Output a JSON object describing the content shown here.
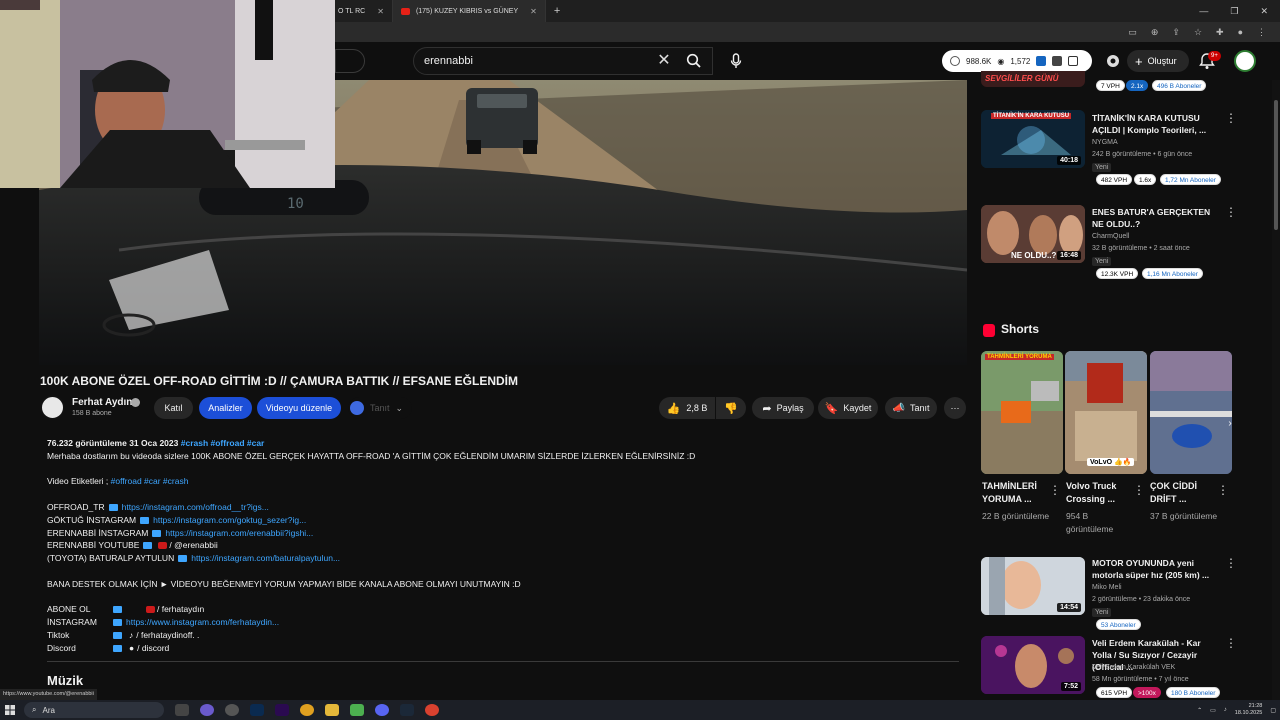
{
  "browser": {
    "tabs": [
      {
        "label": "O TL RC"
      },
      {
        "label": "(175) KUZEY KIBRIS vs GÜNEY"
      }
    ],
    "new_tab": "+"
  },
  "header": {
    "search_value": "erennabbi",
    "stats": {
      "views": "988.6K",
      "watching": "1,572"
    },
    "create_label": "Oluştur",
    "notifications": "9+"
  },
  "video": {
    "title": "100K ABONE ÖZEL OFF-ROAD GİTTİM :D // ÇAMURA BATTIK // EFSANE EĞLENDİM",
    "dash_display": "10"
  },
  "channel": {
    "name": "Ferhat Aydın",
    "subscribers": "158 B abone",
    "join_label": "Katıl",
    "analytics_label": "Analizler",
    "edit_label": "Videoyu düzenle",
    "promote_label": "Tanıt"
  },
  "actions": {
    "likes": "2,8 B",
    "share": "Paylaş",
    "save": "Kaydet",
    "clip": "Tanıt"
  },
  "description": {
    "views_date": "76.232 görüntüleme  31 Oca 2023",
    "hashtags": "#crash #offroad #car",
    "line1": "Merhaba dostlarım bu videoda sizlere 100K ABONE ÖZEL GERÇEK HAYATTA OFF-ROAD 'A GİTTİM ÇOK EĞLENDİM UMARIM SİZLERDE İZLERKEN EĞLENİRSİNİZ :D",
    "tags_label": "Video Etiketleri ; ",
    "tags": "#offroad  #car  #crash",
    "socials": [
      {
        "label": "OFFROAD_TR",
        "link": "https://instagram.com/offroad__tr?igs..."
      },
      {
        "label": "GÖKTUĞ İNSTAGRAM",
        "link": "https://instagram.com/goktug_sezer?ig..."
      },
      {
        "label": "ERENNABBİ İNSTAGRAM",
        "link": "https://instagram.com/erenabbii?igshi..."
      },
      {
        "label": "ERENNABBİ YOUTUBE",
        "link": "/ @erenabbii"
      },
      {
        "label": "(TOYOTA) BATURALP AYTULUN",
        "link": "https://instagram.com/baturalpaytulun..."
      }
    ],
    "support": "BANA DESTEK OLMAK İÇİN ► VİDEOYU BEĞENMEYİ YORUM YAPMAYI BİDE KANALA ABONE OLMAYI UNUTMAYIN :D",
    "links": [
      {
        "label": "ABONE OL",
        "value": "/ ferhataydın"
      },
      {
        "label": "İNSTAGRAM",
        "value": "https://www.instagram.com/ferhataydin..."
      },
      {
        "label": "Tiktok",
        "value": "/ ferhataydinoff.  ."
      },
      {
        "label": "Discord",
        "value": "/ discord"
      }
    ]
  },
  "music_heading": "Müzik",
  "sidebar": {
    "top_badges": {
      "vph": "7 VPH",
      "ratio": "2.1x",
      "subs": "496 B Aboneler"
    },
    "top_thumb_text": "SEVGİLİLER GÜNÜ",
    "videos": [
      {
        "title": "TİTANİK'İN KARA KUTUSU AÇILDI | Komplo Teorileri, ...",
        "channel": "NYGMA",
        "meta": "242 B görüntüleme • 6 gün önce",
        "new": "Yeni",
        "duration": "40:18",
        "vph": "482 VPH",
        "ratio": "1.6x",
        "subs": "1,72 Mn Aboneler",
        "thumb_text": "TİTANİK'İN KARA KUTUSU"
      },
      {
        "title": "ENES BATUR'A GERÇEKTEN NE OLDU..?",
        "channel": "CharmQuell",
        "meta": "32 B görüntüleme • 2 saat önce",
        "new": "Yeni",
        "duration": "16:48",
        "vph": "12.3K VPH",
        "subs": "1,16 Mn Aboneler",
        "thumb_text": "NE OLDU..?"
      },
      {
        "title": "MOTOR OYUNUNDA yeni motorla süper hız (205 km) ...",
        "channel": "Miko Meli",
        "meta": "2 görüntüleme • 23 dakika önce",
        "new": "Yeni",
        "duration": "14:54",
        "subs": "53 Aboneler"
      },
      {
        "title": "Veli Erdem Karakülah - Kar Yolla / Su Sızıyor / Cezayir (Official ...",
        "channel": "Veli Erdem Karakülah VEK",
        "meta": "58 Mn görüntüleme • 7 yıl önce",
        "duration": "7:52",
        "vph": "615 VPH",
        "ratio": ">100x",
        "subs": "180 B Aboneler"
      }
    ],
    "shorts_heading": "Shorts",
    "shorts": [
      {
        "title": "TAHMİNLERİ YORUMA ...",
        "views": "22 B görüntüleme",
        "thumb_text": "TAHMİNLERİ YORUMA"
      },
      {
        "title": "Volvo Truck Crossing ...",
        "views": "954 B görüntüleme",
        "thumb_text": "VoLvO 👍🔥"
      },
      {
        "title": "ÇOK CİDDİ DRİFT ...",
        "views": "37 B görüntüleme"
      }
    ]
  },
  "status_url": "https://www.youtube.com/@erenabbii",
  "taskbar": {
    "search": "Ara",
    "time": "21:28",
    "date": "18.10.2025"
  }
}
